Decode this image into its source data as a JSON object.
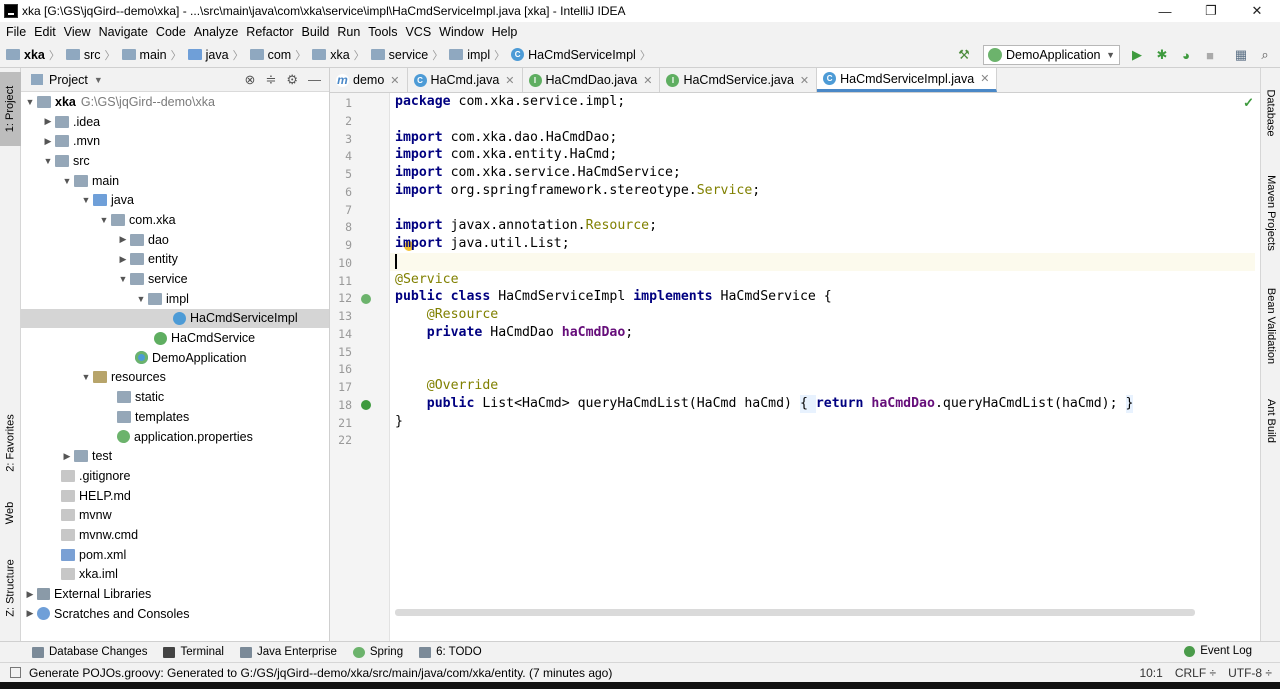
{
  "window": {
    "title": "xka [G:\\GS\\jqGird--demo\\xka] - ...\\src\\main\\java\\com\\xka\\service\\impl\\HaCmdServiceImpl.java [xka] - IntelliJ IDEA",
    "minimize": "—",
    "restore": "❐",
    "close": "✕"
  },
  "menu": [
    "File",
    "Edit",
    "View",
    "Navigate",
    "Code",
    "Analyze",
    "Refactor",
    "Build",
    "Run",
    "Tools",
    "VCS",
    "Window",
    "Help"
  ],
  "breadcrumb": [
    "xka",
    "src",
    "main",
    "java",
    "com",
    "xka",
    "service",
    "impl",
    "HaCmdServiceImpl"
  ],
  "run_config": "DemoApplication",
  "left_tool_tabs": {
    "project": "1: Project",
    "favorites": "2: Favorites",
    "web": "Web",
    "structure": "Z: Structure"
  },
  "project_panel": {
    "header": "Project",
    "tree": [
      {
        "label": "xka",
        "hint": "G:\\GS\\jqGird--demo\\xka"
      },
      {
        "label": ".idea"
      },
      {
        "label": ".mvn"
      },
      {
        "label": "src"
      },
      {
        "label": "main"
      },
      {
        "label": "java"
      },
      {
        "label": "com.xka"
      },
      {
        "label": "dao"
      },
      {
        "label": "entity"
      },
      {
        "label": "service"
      },
      {
        "label": "impl"
      },
      {
        "label": "HaCmdServiceImpl"
      },
      {
        "label": "HaCmdService"
      },
      {
        "label": "DemoApplication"
      },
      {
        "label": "resources"
      },
      {
        "label": "static"
      },
      {
        "label": "templates"
      },
      {
        "label": "application.properties"
      },
      {
        "label": "test"
      },
      {
        "label": ".gitignore"
      },
      {
        "label": "HELP.md"
      },
      {
        "label": "mvnw"
      },
      {
        "label": "mvnw.cmd"
      },
      {
        "label": "pom.xml"
      },
      {
        "label": "xka.iml"
      },
      {
        "label": "External Libraries"
      },
      {
        "label": "Scratches and Consoles"
      }
    ]
  },
  "editor_tabs": [
    "demo",
    "HaCmd.java",
    "HaCmdDao.java",
    "HaCmdService.java",
    "HaCmdServiceImpl.java"
  ],
  "editor": {
    "line_numbers": [
      "1",
      "2",
      "3",
      "4",
      "5",
      "6",
      "7",
      "8",
      "9",
      "10",
      "11",
      "12",
      "13",
      "14",
      "15",
      "16",
      "17",
      "18",
      "21",
      "22"
    ],
    "code": {
      "l1_kw": "package",
      "l1_rest": " com.xka.service.impl;",
      "l3_kw": "import",
      "l3_rest": " com.xka.dao.HaCmdDao;",
      "l4_kw": "import",
      "l4_rest": " com.xka.entity.HaCmd;",
      "l5_kw": "import",
      "l5_rest": " com.xka.service.HaCmdService;",
      "l6_kw": "import",
      "l6_rest": " org.springframework.stereotype.",
      "l6_an": "Service",
      "l6_end": ";",
      "l8_kw": "import",
      "l8_rest": " javax.annotation.",
      "l8_an": "Resource",
      "l8_end": ";",
      "l9_kw": "import",
      "l9_rest": " java.util.List;",
      "l11_an": "@Service",
      "l12_kw1": "public class",
      "l12_mid": " HaCmdServiceImpl ",
      "l12_kw2": "implements",
      "l12_end": " HaCmdService {",
      "l13_an": "@Resource",
      "l14_kw": "private",
      "l14_mid": " HaCmdDao ",
      "l14_fld": "haCmdDao",
      "l14_end": ";",
      "l17_an": "@Override",
      "l18_kw": "public",
      "l18_mid": " List<HaCmd> queryHaCmdList(HaCmd haCmd) ",
      "l18_open": "{ ",
      "l18_kw2": "return",
      "l18_sp": " ",
      "l18_fld": "haCmdDao",
      "l18_end": ".queryHaCmdList(haCmd); ",
      "l18_close": "}",
      "l21": "}"
    }
  },
  "right_tool_tabs": [
    "Database",
    "Maven Projects",
    "Bean Validation",
    "Ant Build"
  ],
  "bottom_tools": [
    "Database Changes",
    "Terminal",
    "Java Enterprise",
    "Spring",
    "6: TODO"
  ],
  "event_log": "Event Log",
  "status": {
    "message": "Generate POJOs.groovy: Generated to G:/GS/jqGird--demo/xka/src/main/java/com/xka/entity. (7 minutes ago)",
    "position": "10:1",
    "line_sep": "CRLF ÷",
    "encoding": "UTF-8 ÷"
  },
  "colors": {
    "keyword": "#000080",
    "annotation": "#808000",
    "field": "#660e7a",
    "tab_underline": "#4a88c7"
  }
}
